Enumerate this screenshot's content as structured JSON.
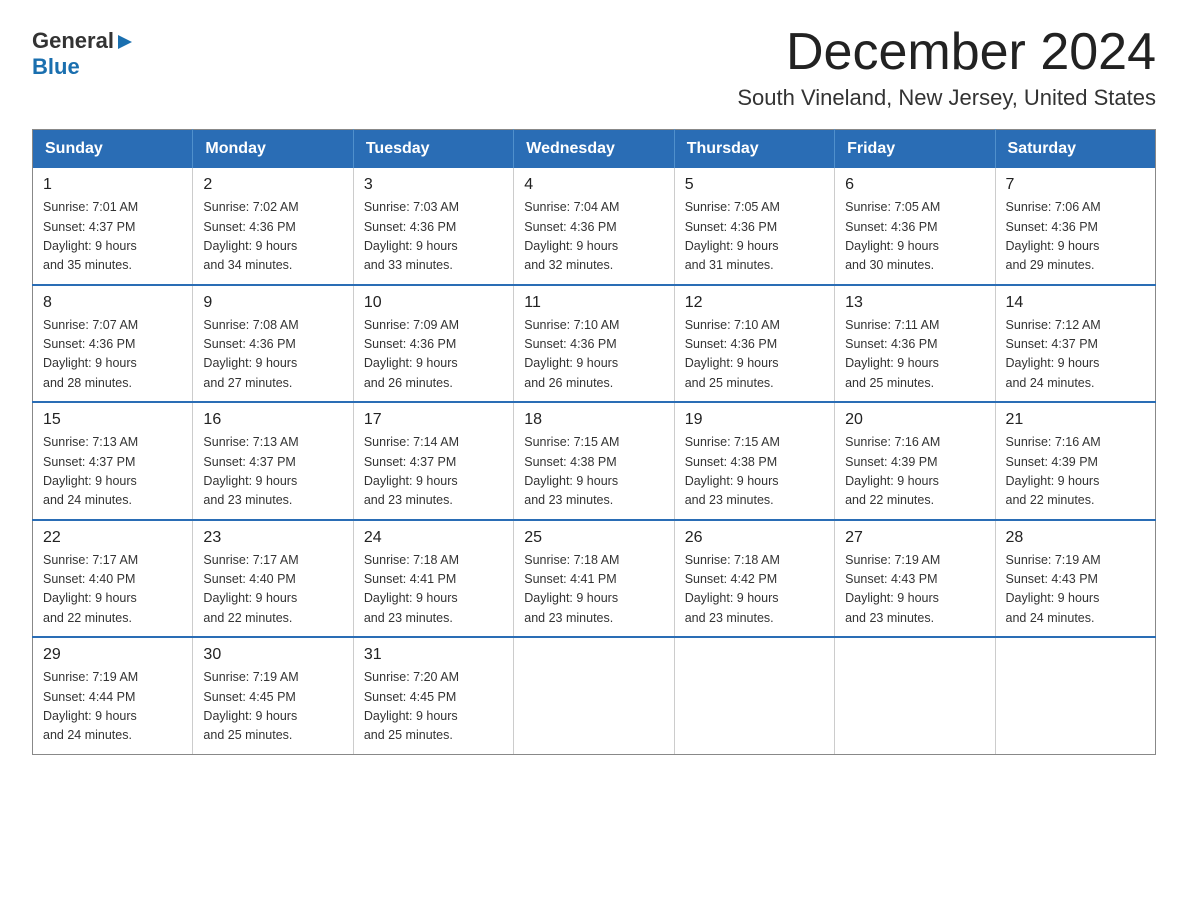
{
  "header": {
    "logo_line1": "General",
    "logo_line2": "Blue",
    "main_title": "December 2024",
    "subtitle": "South Vineland, New Jersey, United States"
  },
  "days_of_week": [
    "Sunday",
    "Monday",
    "Tuesday",
    "Wednesday",
    "Thursday",
    "Friday",
    "Saturday"
  ],
  "weeks": [
    [
      {
        "day": "1",
        "sunrise": "7:01 AM",
        "sunset": "4:37 PM",
        "daylight": "9 hours and 35 minutes."
      },
      {
        "day": "2",
        "sunrise": "7:02 AM",
        "sunset": "4:36 PM",
        "daylight": "9 hours and 34 minutes."
      },
      {
        "day": "3",
        "sunrise": "7:03 AM",
        "sunset": "4:36 PM",
        "daylight": "9 hours and 33 minutes."
      },
      {
        "day": "4",
        "sunrise": "7:04 AM",
        "sunset": "4:36 PM",
        "daylight": "9 hours and 32 minutes."
      },
      {
        "day": "5",
        "sunrise": "7:05 AM",
        "sunset": "4:36 PM",
        "daylight": "9 hours and 31 minutes."
      },
      {
        "day": "6",
        "sunrise": "7:05 AM",
        "sunset": "4:36 PM",
        "daylight": "9 hours and 30 minutes."
      },
      {
        "day": "7",
        "sunrise": "7:06 AM",
        "sunset": "4:36 PM",
        "daylight": "9 hours and 29 minutes."
      }
    ],
    [
      {
        "day": "8",
        "sunrise": "7:07 AM",
        "sunset": "4:36 PM",
        "daylight": "9 hours and 28 minutes."
      },
      {
        "day": "9",
        "sunrise": "7:08 AM",
        "sunset": "4:36 PM",
        "daylight": "9 hours and 27 minutes."
      },
      {
        "day": "10",
        "sunrise": "7:09 AM",
        "sunset": "4:36 PM",
        "daylight": "9 hours and 26 minutes."
      },
      {
        "day": "11",
        "sunrise": "7:10 AM",
        "sunset": "4:36 PM",
        "daylight": "9 hours and 26 minutes."
      },
      {
        "day": "12",
        "sunrise": "7:10 AM",
        "sunset": "4:36 PM",
        "daylight": "9 hours and 25 minutes."
      },
      {
        "day": "13",
        "sunrise": "7:11 AM",
        "sunset": "4:36 PM",
        "daylight": "9 hours and 25 minutes."
      },
      {
        "day": "14",
        "sunrise": "7:12 AM",
        "sunset": "4:37 PM",
        "daylight": "9 hours and 24 minutes."
      }
    ],
    [
      {
        "day": "15",
        "sunrise": "7:13 AM",
        "sunset": "4:37 PM",
        "daylight": "9 hours and 24 minutes."
      },
      {
        "day": "16",
        "sunrise": "7:13 AM",
        "sunset": "4:37 PM",
        "daylight": "9 hours and 23 minutes."
      },
      {
        "day": "17",
        "sunrise": "7:14 AM",
        "sunset": "4:37 PM",
        "daylight": "9 hours and 23 minutes."
      },
      {
        "day": "18",
        "sunrise": "7:15 AM",
        "sunset": "4:38 PM",
        "daylight": "9 hours and 23 minutes."
      },
      {
        "day": "19",
        "sunrise": "7:15 AM",
        "sunset": "4:38 PM",
        "daylight": "9 hours and 23 minutes."
      },
      {
        "day": "20",
        "sunrise": "7:16 AM",
        "sunset": "4:39 PM",
        "daylight": "9 hours and 22 minutes."
      },
      {
        "day": "21",
        "sunrise": "7:16 AM",
        "sunset": "4:39 PM",
        "daylight": "9 hours and 22 minutes."
      }
    ],
    [
      {
        "day": "22",
        "sunrise": "7:17 AM",
        "sunset": "4:40 PM",
        "daylight": "9 hours and 22 minutes."
      },
      {
        "day": "23",
        "sunrise": "7:17 AM",
        "sunset": "4:40 PM",
        "daylight": "9 hours and 22 minutes."
      },
      {
        "day": "24",
        "sunrise": "7:18 AM",
        "sunset": "4:41 PM",
        "daylight": "9 hours and 23 minutes."
      },
      {
        "day": "25",
        "sunrise": "7:18 AM",
        "sunset": "4:41 PM",
        "daylight": "9 hours and 23 minutes."
      },
      {
        "day": "26",
        "sunrise": "7:18 AM",
        "sunset": "4:42 PM",
        "daylight": "9 hours and 23 minutes."
      },
      {
        "day": "27",
        "sunrise": "7:19 AM",
        "sunset": "4:43 PM",
        "daylight": "9 hours and 23 minutes."
      },
      {
        "day": "28",
        "sunrise": "7:19 AM",
        "sunset": "4:43 PM",
        "daylight": "9 hours and 24 minutes."
      }
    ],
    [
      {
        "day": "29",
        "sunrise": "7:19 AM",
        "sunset": "4:44 PM",
        "daylight": "9 hours and 24 minutes."
      },
      {
        "day": "30",
        "sunrise": "7:19 AM",
        "sunset": "4:45 PM",
        "daylight": "9 hours and 25 minutes."
      },
      {
        "day": "31",
        "sunrise": "7:20 AM",
        "sunset": "4:45 PM",
        "daylight": "9 hours and 25 minutes."
      },
      null,
      null,
      null,
      null
    ]
  ],
  "labels": {
    "sunrise": "Sunrise: ",
    "sunset": "Sunset: ",
    "daylight": "Daylight: "
  }
}
